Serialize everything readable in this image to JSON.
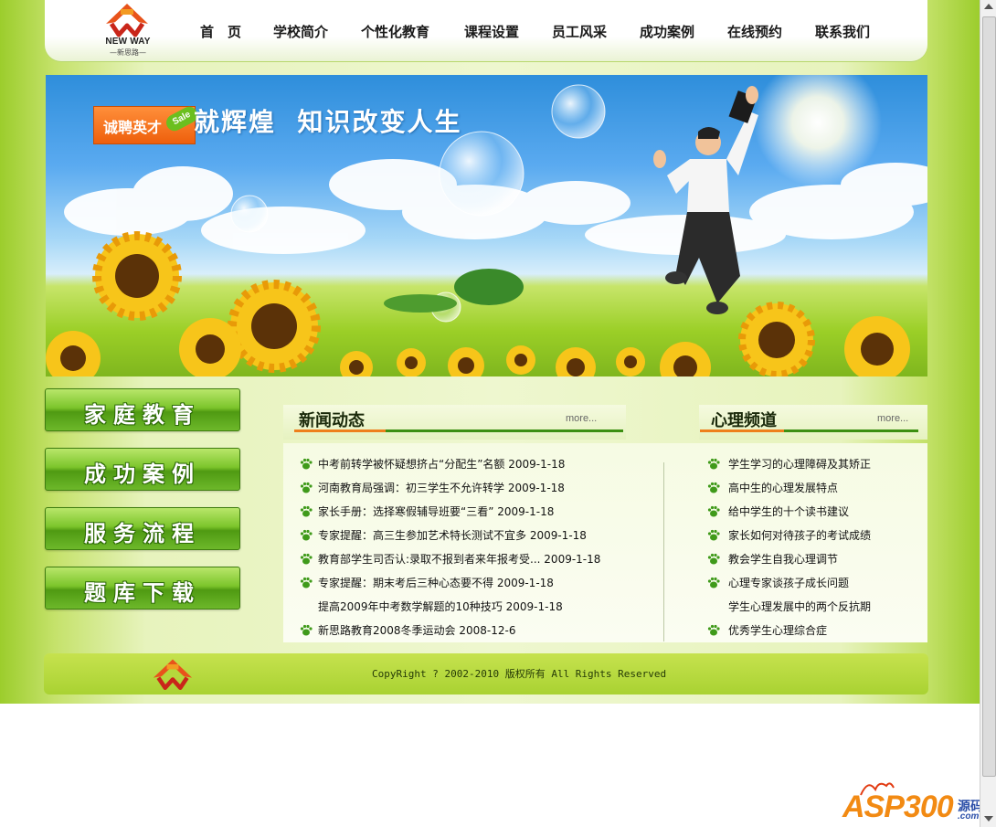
{
  "logo": {
    "name": "NEW WAY",
    "sub": "—新思路—"
  },
  "nav": [
    "首　页",
    "学校简介",
    "个性化教育",
    "课程设置",
    "员工风采",
    "成功案例",
    "在线预约",
    "联系我们"
  ],
  "banner": {
    "badge": "诚聘英才",
    "sale": "Sale",
    "slogan": "就辉煌  知识改变人生"
  },
  "side_buttons": [
    "家庭教育",
    "成功案例",
    "服务流程",
    "题库下载"
  ],
  "news": {
    "title": "新闻动态",
    "more": "more...",
    "items": [
      "中考前转学被怀疑想挤占“分配生”名额 2009-1-18",
      "河南教育局强调：初三学生不允许转学 2009-1-18",
      "家长手册：选择寒假辅导班要“三看”  2009-1-18",
      "专家提醒：高三生参加艺术特长测试不宜多 2009-1-18",
      "教育部学生司否认:录取不报到者来年报考受... 2009-1-18",
      "专家提醒：期末考后三种心态要不得 2009-1-18",
      "提高2009年中考数学解题的10种技巧 2009-1-18",
      "新思路教育2008冬季运动会 2008-12-6"
    ]
  },
  "psych": {
    "title": "心理频道",
    "more": "more...",
    "items": [
      "学生学习的心理障碍及其矫正",
      "高中生的心理发展特点",
      "给中学生的十个读书建议",
      "家长如何对待孩子的考试成绩",
      "教会学生自我心理调节",
      "心理专家谈孩子成长问题",
      "学生心理发展中的两个反抗期",
      "优秀学生心理综合症"
    ]
  },
  "footer": {
    "copyright": "CopyRight ? 2002-2010 版权所有 All Rights Reserved"
  },
  "watermark": {
    "text": "ASP300",
    "sub": "源码",
    "com": ".com"
  },
  "colors": {
    "accent_green": "#7cc52b",
    "footer_green": "#b5d93c",
    "news_line": "#ee7f1c",
    "panel_green": "#4f9a12"
  }
}
